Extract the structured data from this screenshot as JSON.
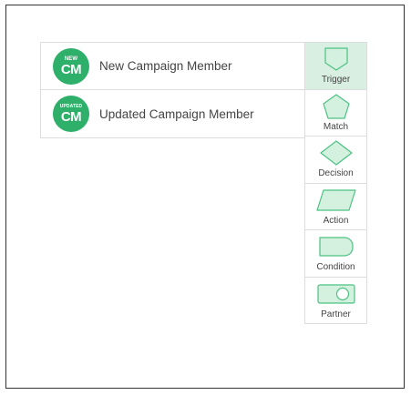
{
  "triggers": [
    {
      "badge_top": "NEW",
      "badge_main": "CM",
      "label": "New Campaign Member"
    },
    {
      "badge_top": "UPDATED",
      "badge_main": "CM",
      "label": "Updated Campaign Member"
    }
  ],
  "palette": [
    {
      "label": "Trigger",
      "icon": "trigger-shape-icon"
    },
    {
      "label": "Match",
      "icon": "pentagon-icon"
    },
    {
      "label": "Decision",
      "icon": "diamond-icon"
    },
    {
      "label": "Action",
      "icon": "parallelogram-icon"
    },
    {
      "label": "Condition",
      "icon": "rounded-tab-icon"
    },
    {
      "label": "Partner",
      "icon": "toggle-shape-icon"
    }
  ],
  "colors": {
    "brand_green": "#2eaf6a",
    "shape_fill": "#d4f0de",
    "shape_stroke": "#4cc283",
    "active_bg": "#d9efe1"
  }
}
